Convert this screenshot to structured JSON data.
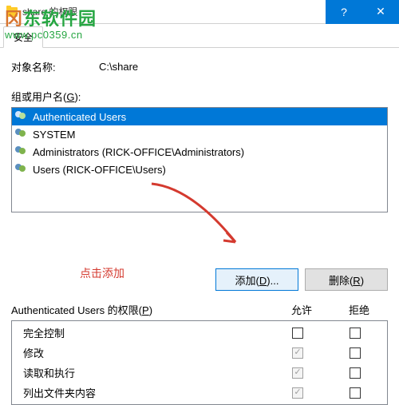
{
  "window": {
    "title": "share 的权限"
  },
  "watermark": {
    "brand_prefix": "冈",
    "brand_rest": "东软件园",
    "url": "www.pc0359.cn"
  },
  "tab": {
    "security": "安全"
  },
  "object": {
    "label": "对象名称:",
    "value": "C:\\share"
  },
  "groups": {
    "label_pre": "组或用户名(",
    "label_u": "G",
    "label_post": "):",
    "items": [
      {
        "name": "Authenticated Users",
        "selected": true
      },
      {
        "name": "SYSTEM",
        "selected": false
      },
      {
        "name": "Administrators (RICK-OFFICE\\Administrators)",
        "selected": false
      },
      {
        "name": "Users (RICK-OFFICE\\Users)",
        "selected": false
      }
    ]
  },
  "hint": "点击添加",
  "buttons": {
    "add_pre": "添加(",
    "add_u": "D",
    "add_post": ")...",
    "remove_pre": "删除(",
    "remove_u": "R",
    "remove_post": ")"
  },
  "perm": {
    "title_pre": "Authenticated Users 的权限(",
    "title_u": "P",
    "title_post": ")",
    "allow": "允许",
    "deny": "拒绝",
    "rows": [
      {
        "name": "完全控制",
        "allow": false,
        "allow_disabled": false,
        "deny": false
      },
      {
        "name": "修改",
        "allow": true,
        "allow_disabled": true,
        "deny": false
      },
      {
        "name": "读取和执行",
        "allow": true,
        "allow_disabled": true,
        "deny": false
      },
      {
        "name": "列出文件夹内容",
        "allow": true,
        "allow_disabled": true,
        "deny": false
      }
    ]
  }
}
